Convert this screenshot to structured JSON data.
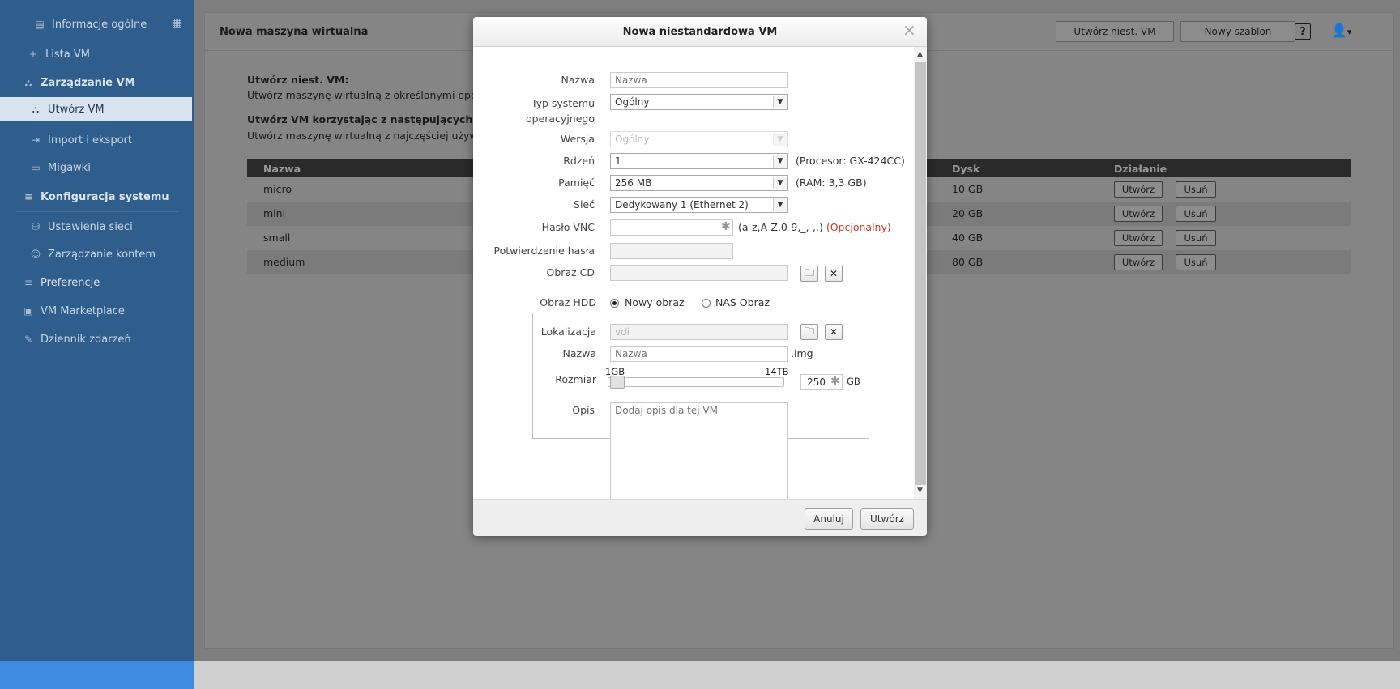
{
  "sidebar": {
    "items": [
      {
        "label": "Informacje ogólne",
        "icon": "overview-icon"
      },
      {
        "label": "Lista VM",
        "icon": "plus-icon"
      },
      {
        "label": "Zarządzanie VM",
        "icon": "vm-management-icon"
      },
      {
        "label": "Utwórz VM",
        "icon": "create-vm-icon"
      },
      {
        "label": "Import i eksport",
        "icon": "import-export-icon"
      },
      {
        "label": "Migawki",
        "icon": "snapshot-icon"
      },
      {
        "label": "Konfiguracja systemu",
        "icon": "system-config-icon"
      },
      {
        "label": "Ustawienia sieci",
        "icon": "network-icon"
      },
      {
        "label": "Zarządzanie kontem",
        "icon": "accounts-icon"
      },
      {
        "label": "Preferencje",
        "icon": "preferences-icon"
      },
      {
        "label": "VM Marketplace",
        "icon": "marketplace-icon"
      },
      {
        "label": "Dziennik zdarzeń",
        "icon": "log-icon"
      }
    ]
  },
  "header": {
    "title": "Nowa maszyna wirtualna",
    "create_custom_btn": "Utwórz niest. VM",
    "new_template_btn": "Nowy szablon",
    "help": "?",
    "user_caret": "▾"
  },
  "main": {
    "custom_heading": "Utwórz niest. VM:",
    "custom_desc": "Utwórz maszynę wirtualną z określonymi opcjar",
    "template_heading": "Utwórz VM korzystając z następujących sza",
    "template_desc": "Utwórz maszynę wirtualną z najczęściej używa",
    "table": {
      "columns": [
        "Nazwa",
        "Dysk",
        "Działanie"
      ],
      "rows": [
        {
          "name": "micro",
          "disk": "10 GB"
        },
        {
          "name": "mini",
          "disk": "20 GB"
        },
        {
          "name": "small",
          "disk": "40 GB"
        },
        {
          "name": "medium",
          "disk": "80 GB"
        }
      ],
      "create_btn": "Utwórz",
      "delete_btn": "Usuń"
    }
  },
  "dialog": {
    "title": "Nowa niestandardowa VM",
    "close": "×",
    "name_label": "Nazwa",
    "name_placeholder": "Nazwa",
    "os_label": "Typ systemu operacyjnego",
    "os_value": "Ogólny",
    "version_label": "Wersja",
    "version_value": "Ogólny",
    "core_label": "Rdzeń",
    "core_value": "1",
    "core_hint": "(Procesor: GX-424CC)",
    "memory_label": "Pamięć",
    "memory_value": "256 MB",
    "memory_hint": "(RAM: 3,3 GB)",
    "network_label": "Sieć",
    "network_value": "Dedykowany 1 (Ethernet 2)",
    "vnc_label": "Hasło VNC",
    "vnc_hint": "(a-z,A-Z,0-9,_,-,.)",
    "vnc_optional": "(Opcjonalny)",
    "confirm_label": "Potwierdzenie hasła",
    "cd_label": "Obraz CD",
    "hdd_label": "Obraz HDD",
    "hdd_new": "Nowy obraz",
    "hdd_nas": "NAS Obraz",
    "location_label": "Lokalizacja",
    "location_value": "vdi",
    "hdd_name_label": "Nazwa",
    "hdd_name_placeholder": "Nazwa",
    "hdd_ext": ".img",
    "size_label": "Rozmiar",
    "size_min": "1GB",
    "size_max": "14TB",
    "size_value": "250",
    "size_unit": "GB",
    "size_fraction": 0.017,
    "desc_label": "Opis",
    "desc_placeholder": "Dodaj opis dla tej VM",
    "cancel_btn": "Anuluj",
    "create_btn": "Utwórz"
  }
}
